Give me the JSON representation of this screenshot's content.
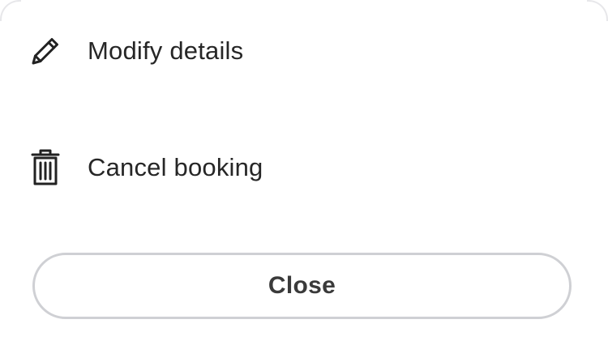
{
  "sheet": {
    "actions": [
      {
        "label": "Modify details",
        "icon": "pencil-icon"
      },
      {
        "label": "Cancel booking",
        "icon": "trash-icon"
      }
    ],
    "close_label": "Close"
  },
  "colors": {
    "text": "#262626",
    "button_border": "#cfd0d4",
    "background": "#ffffff"
  }
}
